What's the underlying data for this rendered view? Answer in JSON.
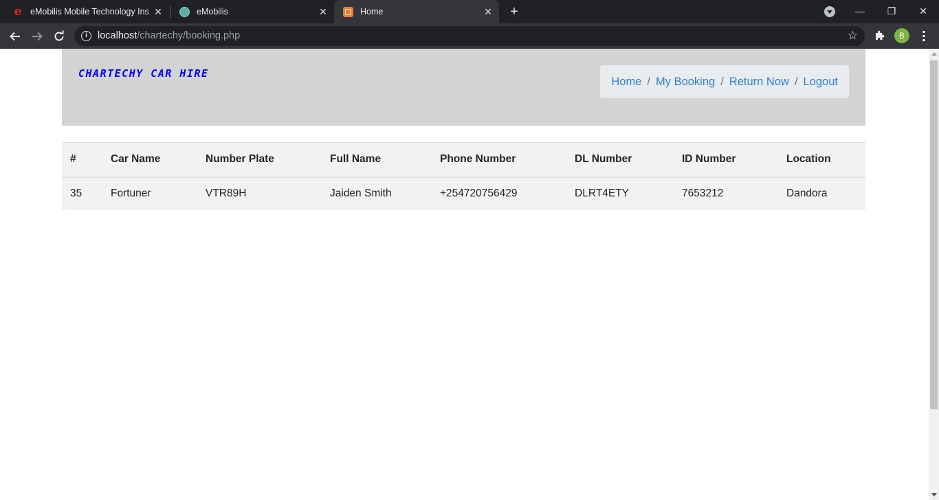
{
  "browser": {
    "tabs": [
      {
        "title": "eMobilis Mobile Technology Insti",
        "favicon": "emobilis-e-icon",
        "active": false
      },
      {
        "title": "eMobilis",
        "favicon": "globe-icon",
        "active": false
      },
      {
        "title": "Home",
        "favicon": "xampp-icon",
        "active": true
      }
    ],
    "url_host": "localhost",
    "url_path": "/chartechy/booking.php",
    "profile_initial": "B"
  },
  "page": {
    "brand": "CHARTECHY CAR HIRE",
    "nav": {
      "home": "Home",
      "my_booking": "My Booking",
      "return_now": "Return Now",
      "logout": "Logout",
      "separator": "/"
    },
    "table": {
      "headers": [
        "#",
        "Car Name",
        "Number Plate",
        "Full Name",
        "Phone Number",
        "DL Number",
        "ID Number",
        "Location"
      ],
      "rows": [
        [
          "35",
          "Fortuner",
          "VTR89H",
          "Jaiden Smith",
          "+254720756429",
          "DLRT4ETY",
          "7653212",
          "Dandora"
        ]
      ]
    }
  },
  "colors": {
    "brand": "#0000ff",
    "link": "#2f7fd8",
    "header_bg": "#d3d3d3",
    "breadcrumb_bg": "#e9ecef",
    "table_bg": "#f2f2f2"
  }
}
